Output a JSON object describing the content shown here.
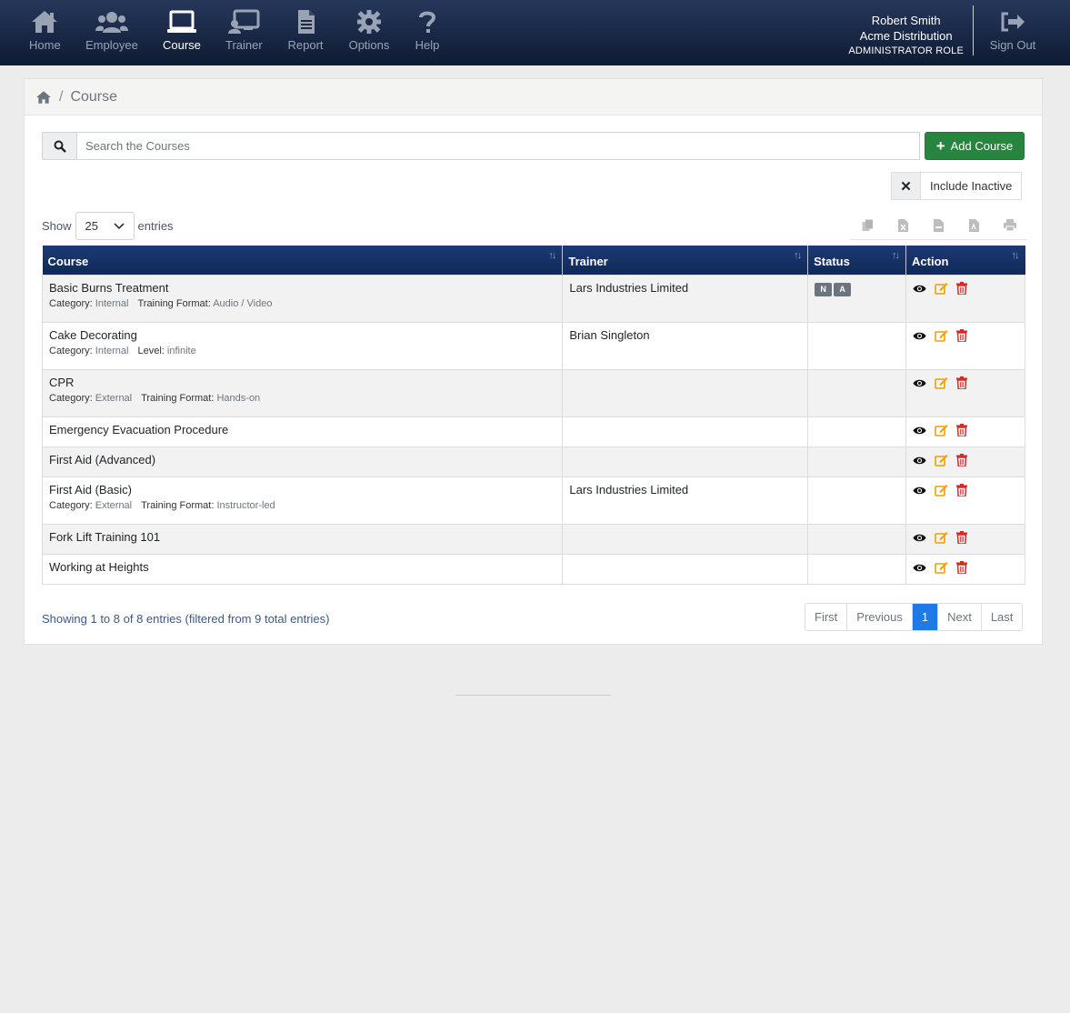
{
  "nav": {
    "items": [
      {
        "label": "Home",
        "icon": "home-icon"
      },
      {
        "label": "Employee",
        "icon": "users-icon"
      },
      {
        "label": "Course",
        "icon": "laptop-icon"
      },
      {
        "label": "Trainer",
        "icon": "presentation-icon"
      },
      {
        "label": "Report",
        "icon": "file-icon"
      },
      {
        "label": "Options",
        "icon": "gear-icon"
      },
      {
        "label": "Help",
        "icon": "question-icon"
      }
    ],
    "user_name": "Robert Smith",
    "company": "Acme Distribution",
    "role": "ADMINISTRATOR ROLE",
    "sign_out": "Sign Out"
  },
  "breadcrumb": {
    "current": "Course",
    "separator": "/"
  },
  "search": {
    "placeholder": "Search the Courses"
  },
  "add_button": "Add Course",
  "include_inactive": "Include Inactive",
  "show": {
    "prefix": "Show",
    "value": "25",
    "suffix": "entries"
  },
  "table": {
    "headers": [
      "Course",
      "Trainer",
      "Status",
      "Action"
    ],
    "rows": [
      {
        "name": "Basic Burns Treatment",
        "trainer": "Lars Industries Limited",
        "meta": [
          {
            "k": "Category:",
            "v": "Internal"
          },
          {
            "k": "Training Format:",
            "v": "Audio / Video"
          }
        ],
        "badges": [
          "N",
          "A"
        ]
      },
      {
        "name": "Cake Decorating",
        "trainer": "Brian Singleton",
        "meta": [
          {
            "k": "Category:",
            "v": "Internal"
          },
          {
            "k": "Level:",
            "v": "infinite"
          }
        ],
        "badges": []
      },
      {
        "name": "CPR",
        "trainer": "",
        "meta": [
          {
            "k": "Category:",
            "v": "External"
          },
          {
            "k": "Training Format:",
            "v": "Hands-on"
          }
        ],
        "badges": []
      },
      {
        "name": "Emergency Evacuation Procedure",
        "trainer": "",
        "meta": [],
        "badges": []
      },
      {
        "name": "First Aid (Advanced)",
        "trainer": "",
        "meta": [],
        "badges": []
      },
      {
        "name": "First Aid (Basic)",
        "trainer": "Lars Industries Limited",
        "meta": [
          {
            "k": "Category:",
            "v": "External"
          },
          {
            "k": "Training Format:",
            "v": "Instructor-led"
          }
        ],
        "badges": []
      },
      {
        "name": "Fork Lift Training 101",
        "trainer": "",
        "meta": [],
        "badges": []
      },
      {
        "name": "Working at Heights",
        "trainer": "",
        "meta": [],
        "badges": []
      }
    ]
  },
  "info": "Showing 1 to 8 of 8 entries (filtered from 9 total entries)",
  "pagination": {
    "first": "First",
    "previous": "Previous",
    "current": "1",
    "next": "Next",
    "last": "Last"
  },
  "colors": {
    "navbar": "#1a2a48",
    "add_button": "#28853f",
    "table_header": "#163267",
    "edit_icon": "#f0a000",
    "delete_icon": "#d42a2a",
    "active_page": "#1f7ae6"
  }
}
